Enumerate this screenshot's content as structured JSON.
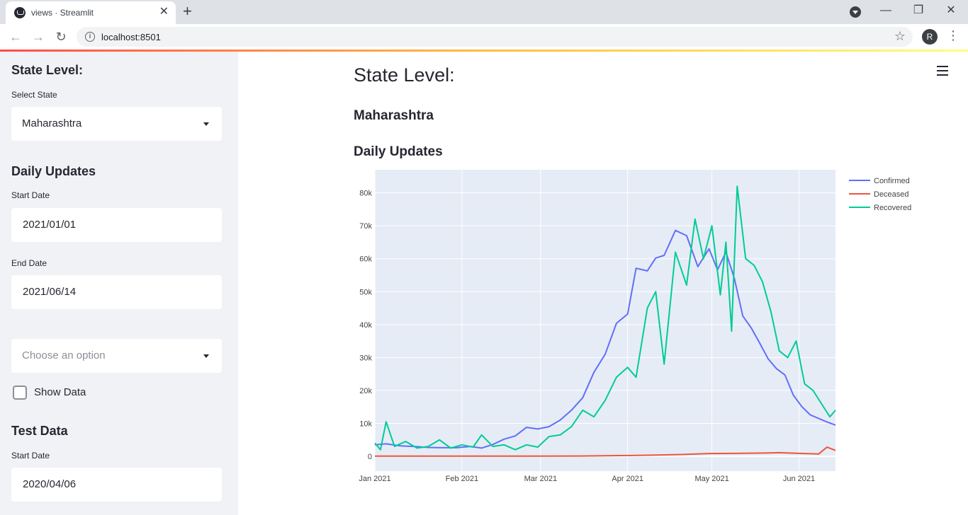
{
  "browser": {
    "tab_title": "views · Streamlit",
    "tab_close": "✕",
    "new_tab": "+",
    "url": "localhost:8501",
    "profile_initial": "R",
    "win_min": "—",
    "win_restore": "❐",
    "win_close": "✕"
  },
  "sidebar": {
    "state_heading": "State Level:",
    "select_state_label": "Select State",
    "select_state_value": "Maharashtra",
    "daily_heading": "Daily Updates",
    "start_date_label": "Start Date",
    "start_date_value": "2021/01/01",
    "end_date_label": "End Date",
    "end_date_value": "2021/06/14",
    "choose_placeholder": "Choose an option",
    "show_data_label": "Show Data",
    "test_heading": "Test Data",
    "test_start_label": "Start Date",
    "test_start_value": "2020/04/06"
  },
  "main": {
    "title": "State Level:",
    "state_name": "Maharashtra",
    "section": "Daily Updates"
  },
  "colors": {
    "confirmed": "#636efa",
    "deceased": "#ef553b",
    "recovered": "#00cc96",
    "plot_bg": "#e5ecf6"
  },
  "chart_data": {
    "type": "line",
    "title": "",
    "xlabel": "",
    "ylabel": "",
    "x_range": [
      "2021-01-01",
      "2021-06-14"
    ],
    "ylim": [
      -4500,
      87000
    ],
    "grid": true,
    "legend_position": "right",
    "x_ticks": [
      "Jan 2021",
      "Feb 2021",
      "Mar 2021",
      "Apr 2021",
      "May 2021",
      "Jun 2021"
    ],
    "y_ticks": [
      "0",
      "10k",
      "20k",
      "30k",
      "40k",
      "50k",
      "60k",
      "70k",
      "80k"
    ],
    "series": [
      {
        "name": "Confirmed",
        "x": [
          "2021-01-01",
          "2021-01-05",
          "2021-01-10",
          "2021-01-15",
          "2021-01-20",
          "2021-01-25",
          "2021-01-30",
          "2021-02-04",
          "2021-02-08",
          "2021-02-12",
          "2021-02-16",
          "2021-02-20",
          "2021-02-24",
          "2021-02-28",
          "2021-03-04",
          "2021-03-08",
          "2021-03-12",
          "2021-03-16",
          "2021-03-20",
          "2021-03-24",
          "2021-03-28",
          "2021-04-01",
          "2021-04-04",
          "2021-04-08",
          "2021-04-11",
          "2021-04-14",
          "2021-04-18",
          "2021-04-22",
          "2021-04-26",
          "2021-04-30",
          "2021-05-03",
          "2021-05-06",
          "2021-05-09",
          "2021-05-12",
          "2021-05-15",
          "2021-05-18",
          "2021-05-21",
          "2021-05-24",
          "2021-05-27",
          "2021-05-30",
          "2021-06-02",
          "2021-06-05",
          "2021-06-08",
          "2021-06-11",
          "2021-06-14"
        ],
        "y": [
          3500,
          3800,
          3200,
          3000,
          2700,
          2600,
          2600,
          3000,
          2500,
          3600,
          5200,
          6200,
          8800,
          8300,
          9000,
          11000,
          14000,
          17800,
          25500,
          31000,
          40400,
          43200,
          57100,
          56300,
          60200,
          61000,
          68600,
          67000,
          57600,
          63000,
          56600,
          62000,
          54000,
          42600,
          39000,
          34400,
          29600,
          26600,
          24700,
          18600,
          15100,
          12600,
          11500,
          10400,
          9500
        ]
      },
      {
        "name": "Deceased",
        "x": [
          "2021-01-01",
          "2021-01-15",
          "2021-02-01",
          "2021-02-15",
          "2021-03-01",
          "2021-03-15",
          "2021-04-01",
          "2021-04-10",
          "2021-04-20",
          "2021-04-30",
          "2021-05-10",
          "2021-05-20",
          "2021-05-25",
          "2021-06-01",
          "2021-06-08",
          "2021-06-11",
          "2021-06-14"
        ],
        "y": [
          50,
          50,
          50,
          60,
          80,
          100,
          250,
          350,
          550,
          850,
          900,
          1000,
          1100,
          900,
          700,
          2800,
          1800
        ]
      },
      {
        "name": "Recovered",
        "x": [
          "2021-01-01",
          "2021-01-03",
          "2021-01-05",
          "2021-01-08",
          "2021-01-12",
          "2021-01-16",
          "2021-01-20",
          "2021-01-24",
          "2021-01-28",
          "2021-02-01",
          "2021-02-05",
          "2021-02-08",
          "2021-02-12",
          "2021-02-16",
          "2021-02-20",
          "2021-02-24",
          "2021-02-28",
          "2021-03-04",
          "2021-03-08",
          "2021-03-12",
          "2021-03-16",
          "2021-03-20",
          "2021-03-24",
          "2021-03-28",
          "2021-04-01",
          "2021-04-04",
          "2021-04-08",
          "2021-04-11",
          "2021-04-14",
          "2021-04-18",
          "2021-04-22",
          "2021-04-25",
          "2021-04-28",
          "2021-05-01",
          "2021-05-04",
          "2021-05-06",
          "2021-05-08",
          "2021-05-10",
          "2021-05-13",
          "2021-05-16",
          "2021-05-19",
          "2021-05-22",
          "2021-05-25",
          "2021-05-28",
          "2021-05-31",
          "2021-06-03",
          "2021-06-06",
          "2021-06-09",
          "2021-06-12",
          "2021-06-14"
        ],
        "y": [
          4000,
          2000,
          10500,
          3000,
          4500,
          2500,
          3000,
          5000,
          2500,
          3500,
          2800,
          6500,
          3000,
          3500,
          2000,
          3500,
          2800,
          6000,
          6500,
          9000,
          14000,
          12000,
          17000,
          24000,
          27000,
          24000,
          45000,
          50000,
          28000,
          62000,
          52000,
          72000,
          60000,
          70000,
          49000,
          65000,
          38000,
          82000,
          60000,
          58000,
          53000,
          44000,
          32000,
          30000,
          35000,
          22000,
          20000,
          16000,
          12000,
          14000
        ]
      }
    ]
  }
}
